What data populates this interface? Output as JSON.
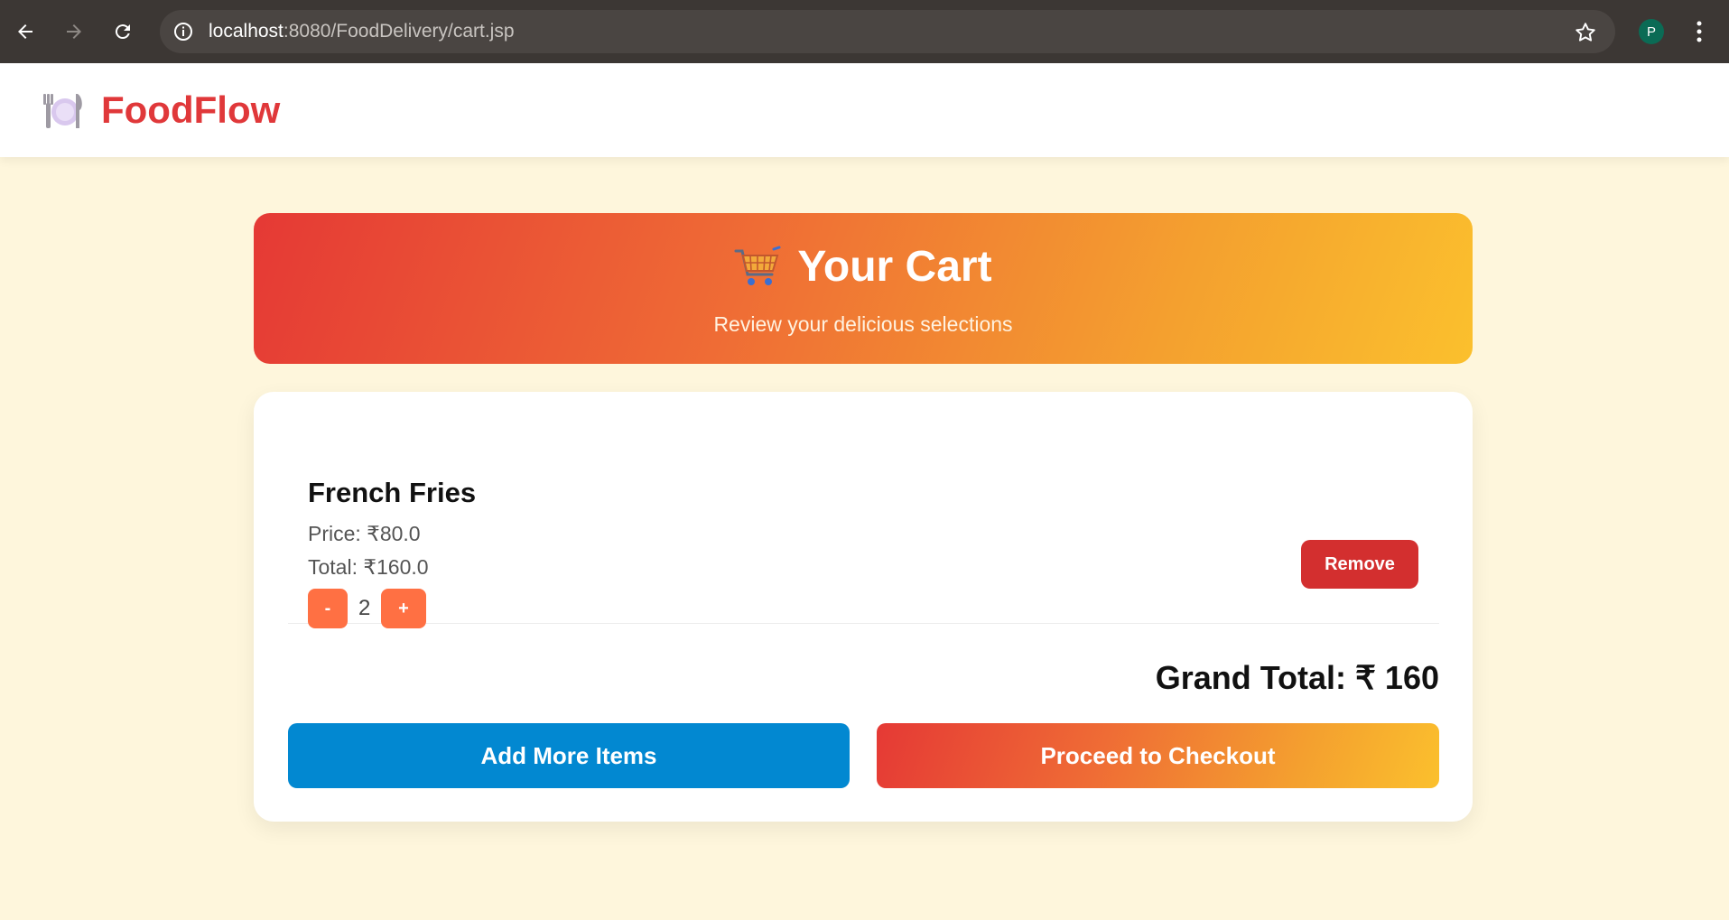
{
  "browser": {
    "url_host": "localhost",
    "url_path": ":8080/FoodDelivery/cart.jsp",
    "profile_initial": "P"
  },
  "header": {
    "brand": "FoodFlow",
    "brand_color": "#e0383a"
  },
  "hero": {
    "title": "Your Cart",
    "subtitle": "Review your delicious selections"
  },
  "cart": {
    "items": [
      {
        "name": "French Fries",
        "price_text": "Price: ₹80.0",
        "total_text": "Total: ₹160.0",
        "quantity": "2",
        "minus_label": "-",
        "plus_label": "+",
        "remove_label": "Remove"
      }
    ],
    "grand_total": "Grand Total: ₹ 160",
    "add_more_label": "Add More Items",
    "checkout_label": "Proceed to Checkout"
  },
  "colors": {
    "page_bg": "#fef6dc",
    "remove": "#d32f2f",
    "add_more": "#0288d1",
    "qty_button": "#ff7043"
  }
}
